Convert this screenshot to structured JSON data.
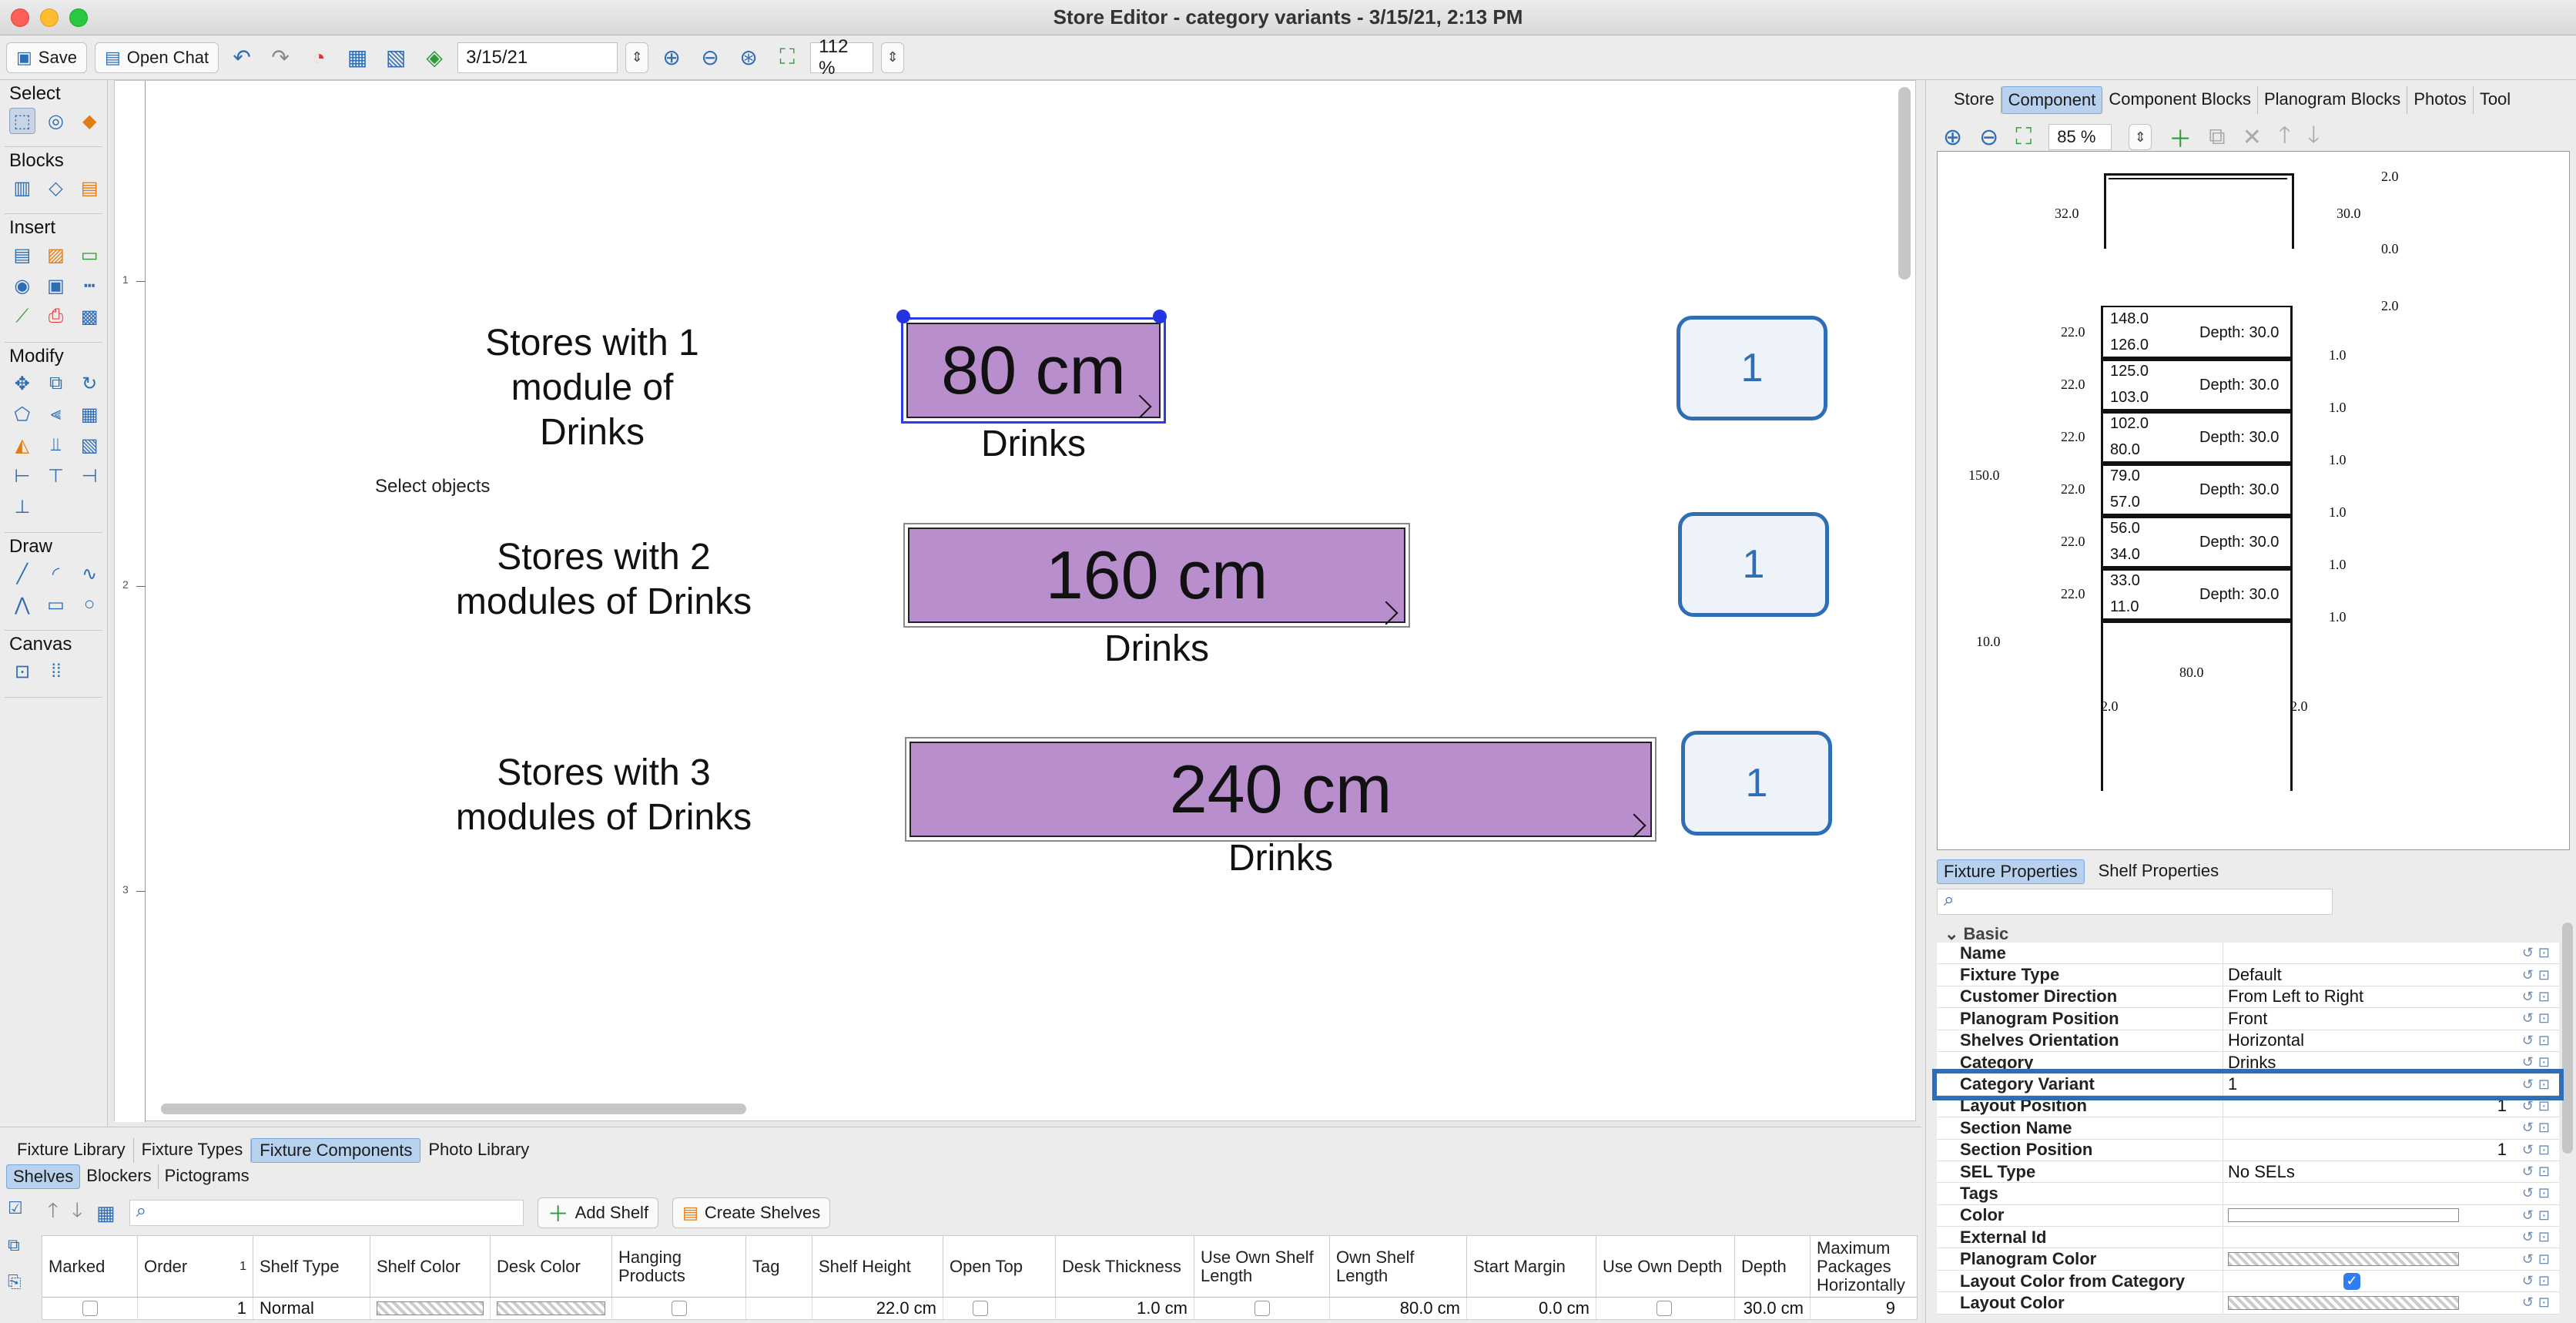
{
  "window": {
    "title": "Store Editor - category variants - 3/15/21, 2:13 PM"
  },
  "toolbar": {
    "save_label": "Save",
    "open_chat_label": "Open Chat",
    "date_value": "3/15/21",
    "zoom_value": "112 %"
  },
  "palette": {
    "select_title": "Select",
    "blocks_title": "Blocks",
    "insert_title": "Insert",
    "modify_title": "Modify",
    "draw_title": "Draw",
    "canvas_title": "Canvas"
  },
  "canvas": {
    "select_hint": "Select objects",
    "ruler_labels": [
      "1",
      "2",
      "3"
    ],
    "rows": [
      {
        "label_line1": "Stores with 1",
        "label_line2": "module of Drinks",
        "block_value": "80 cm",
        "block_category": "Drinks",
        "count": "1"
      },
      {
        "label_line1": "Stores with 2",
        "label_line2": "modules of Drinks",
        "block_value": "160 cm",
        "block_category": "Drinks",
        "count": "1"
      },
      {
        "label_line1": "Stores with 3",
        "label_line2": "modules of Drinks",
        "block_value": "240 cm",
        "block_category": "Drinks",
        "count": "1"
      }
    ]
  },
  "right_panel": {
    "tabs": [
      "Store",
      "Component",
      "Component Blocks",
      "Planogram Blocks",
      "Photos",
      "Tool"
    ],
    "active_tab": "Component",
    "zoom_value": "85 %",
    "preview": {
      "top_dims": [
        "32.0",
        "30.0",
        "2.0",
        "0.0",
        "2.0"
      ],
      "height_total": "150.0",
      "base": "10.0",
      "width": "80.0",
      "foot_left": "2.0",
      "foot_right": "2.0",
      "shelves": [
        {
          "top": "148.0",
          "bottom": "126.0",
          "depth": "Depth: 30.0",
          "gap": "22.0",
          "thickness": "1.0"
        },
        {
          "top": "125.0",
          "bottom": "103.0",
          "depth": "Depth: 30.0",
          "gap": "22.0",
          "thickness": "1.0"
        },
        {
          "top": "102.0",
          "bottom": "80.0",
          "depth": "Depth: 30.0",
          "gap": "22.0",
          "thickness": "1.0"
        },
        {
          "top": "79.0",
          "bottom": "57.0",
          "depth": "Depth: 30.0",
          "gap": "22.0",
          "thickness": "1.0"
        },
        {
          "top": "56.0",
          "bottom": "34.0",
          "depth": "Depth: 30.0",
          "gap": "22.0",
          "thickness": "1.0"
        },
        {
          "top": "33.0",
          "bottom": "11.0",
          "depth": "Depth: 30.0",
          "gap": "22.0",
          "thickness": "1.0"
        }
      ]
    },
    "prop_tabs": [
      "Fixture Properties",
      "Shelf Properties"
    ],
    "section": "Basic",
    "properties": [
      {
        "name": "Name",
        "value": ""
      },
      {
        "name": "Fixture Type",
        "value": "Default"
      },
      {
        "name": "Customer Direction",
        "value": "From Left to Right"
      },
      {
        "name": "Planogram Position",
        "value": "Front"
      },
      {
        "name": "Shelves Orientation",
        "value": "Horizontal"
      },
      {
        "name": "Category",
        "value": "Drinks"
      },
      {
        "name": "Category Variant",
        "value": "1"
      },
      {
        "name": "Layout Position",
        "value": "1"
      },
      {
        "name": "Section Name",
        "value": ""
      },
      {
        "name": "Section Position",
        "value": "1"
      },
      {
        "name": "SEL Type",
        "value": "No SELs"
      },
      {
        "name": "Tags",
        "value": ""
      },
      {
        "name": "Color",
        "value": ""
      },
      {
        "name": "External Id",
        "value": ""
      },
      {
        "name": "Planogram Color",
        "value": ""
      },
      {
        "name": "Layout Color from Category",
        "value": ""
      },
      {
        "name": "Layout Color",
        "value": ""
      }
    ]
  },
  "bottom_panel": {
    "tabs": [
      "Fixture Library",
      "Fixture Types",
      "Fixture Components",
      "Photo Library"
    ],
    "active_tab": "Fixture Components",
    "subtabs": [
      "Shelves",
      "Blockers",
      "Pictograms"
    ],
    "active_subtab": "Shelves",
    "add_shelf_label": "Add Shelf",
    "create_shelves_label": "Create Shelves",
    "columns": [
      "Marked",
      "Order",
      "Shelf Type",
      "Shelf Color",
      "Desk Color",
      "Hanging Products",
      "Tag",
      "Shelf Height",
      "Open Top",
      "Desk Thickness",
      "Use Own Shelf Length",
      "Own Shelf Length",
      "Start Margin",
      "Use Own Depth",
      "Depth",
      "Maximum Packages Horizontally"
    ],
    "sort_indicator": "1",
    "row": {
      "order": "1",
      "shelf_type": "Normal",
      "shelf_height": "22.0 cm",
      "desk_thickness": "1.0 cm",
      "own_shelf_length": "80.0 cm",
      "start_margin": "0.0 cm",
      "depth": "30.0 cm",
      "max_packages": "9"
    }
  }
}
